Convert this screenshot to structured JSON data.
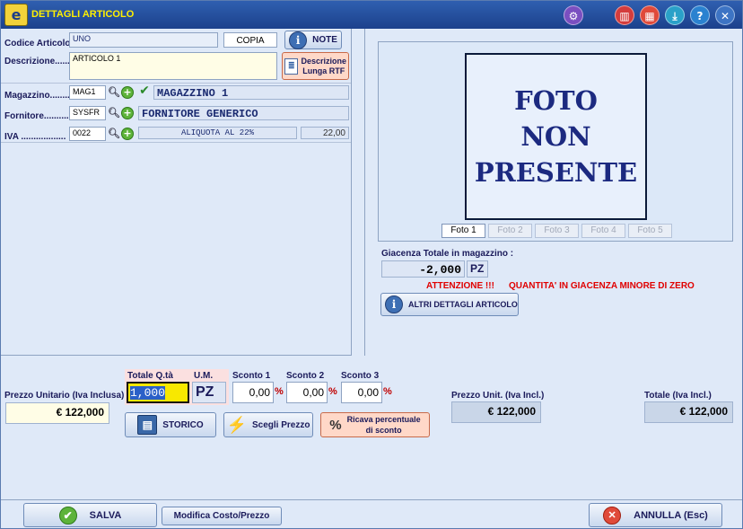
{
  "window": {
    "title": "DETTAGLI ARTICOLO"
  },
  "toolbar_icons": [
    "settings-icon",
    "library-icon",
    "calculator-icon",
    "download-icon",
    "help-icon",
    "close-icon"
  ],
  "article": {
    "code_label": "Codice Articolo",
    "code_value": "UNO",
    "copy_label": "COPIA",
    "note_label": "NOTE",
    "desc_label": "Descrizione.......",
    "desc_value": "ARTICOLO 1",
    "rtf_label_1": "Descrizione",
    "rtf_label_2": "Lunga RTF"
  },
  "warehouse": {
    "label": "Magazzino.........",
    "code": "MAG1",
    "name": "MAGAZZINO 1"
  },
  "supplier": {
    "label": "Fornitore..........",
    "code": "SYSFR",
    "name": "FORNITORE GENERICO"
  },
  "vat": {
    "label": "IVA ..................",
    "code": "0022",
    "description": "ALIQUOTA AL 22%",
    "rate": "22,00"
  },
  "photo": {
    "line1": "FOTO",
    "line2": "NON",
    "line3": "PRESENTE",
    "tabs": [
      "Foto 1",
      "Foto 2",
      "Foto 3",
      "Foto 4",
      "Foto 5"
    ]
  },
  "stock": {
    "label": "Giacenza Totale in magazzino :",
    "value": "-2,000",
    "unit": "PZ",
    "warning_1": "ATTENZIONE !!!",
    "warning_2": "QUANTITA' IN GIACENZA MINORE DI ZERO",
    "details_button": "ALTRI DETTAGLI ARTICOLO"
  },
  "pricing": {
    "unit_price_label": "Prezzo Unitario (Iva Inclusa)",
    "unit_price_value": "€ 122,000",
    "qty_label": "Totale Q.tà",
    "qty_value": "1,000",
    "um_label": "U.M.",
    "um_value": "PZ",
    "discount1_label": "Sconto 1",
    "discount1_value": "0,00",
    "discount2_label": "Sconto 2",
    "discount2_value": "0,00",
    "discount3_label": "Sconto 3",
    "discount3_value": "0,00",
    "percent_sign": "%",
    "net_unit_label": "Prezzo Unit. (Iva Incl.)",
    "net_unit_value": "€ 122,000",
    "total_label": "Totale (Iva Incl.)",
    "total_value": "€ 122,000",
    "history_button": "STORICO",
    "choose_price_button": "Scegli Prezzo",
    "calc_discount_1": "Ricava percentuale",
    "calc_discount_2": "di sconto"
  },
  "footer": {
    "save_button": "SALVA",
    "edit_cost_button": "Modifica Costo/Prezzo",
    "cancel_button": "ANNULLA (Esc)"
  }
}
